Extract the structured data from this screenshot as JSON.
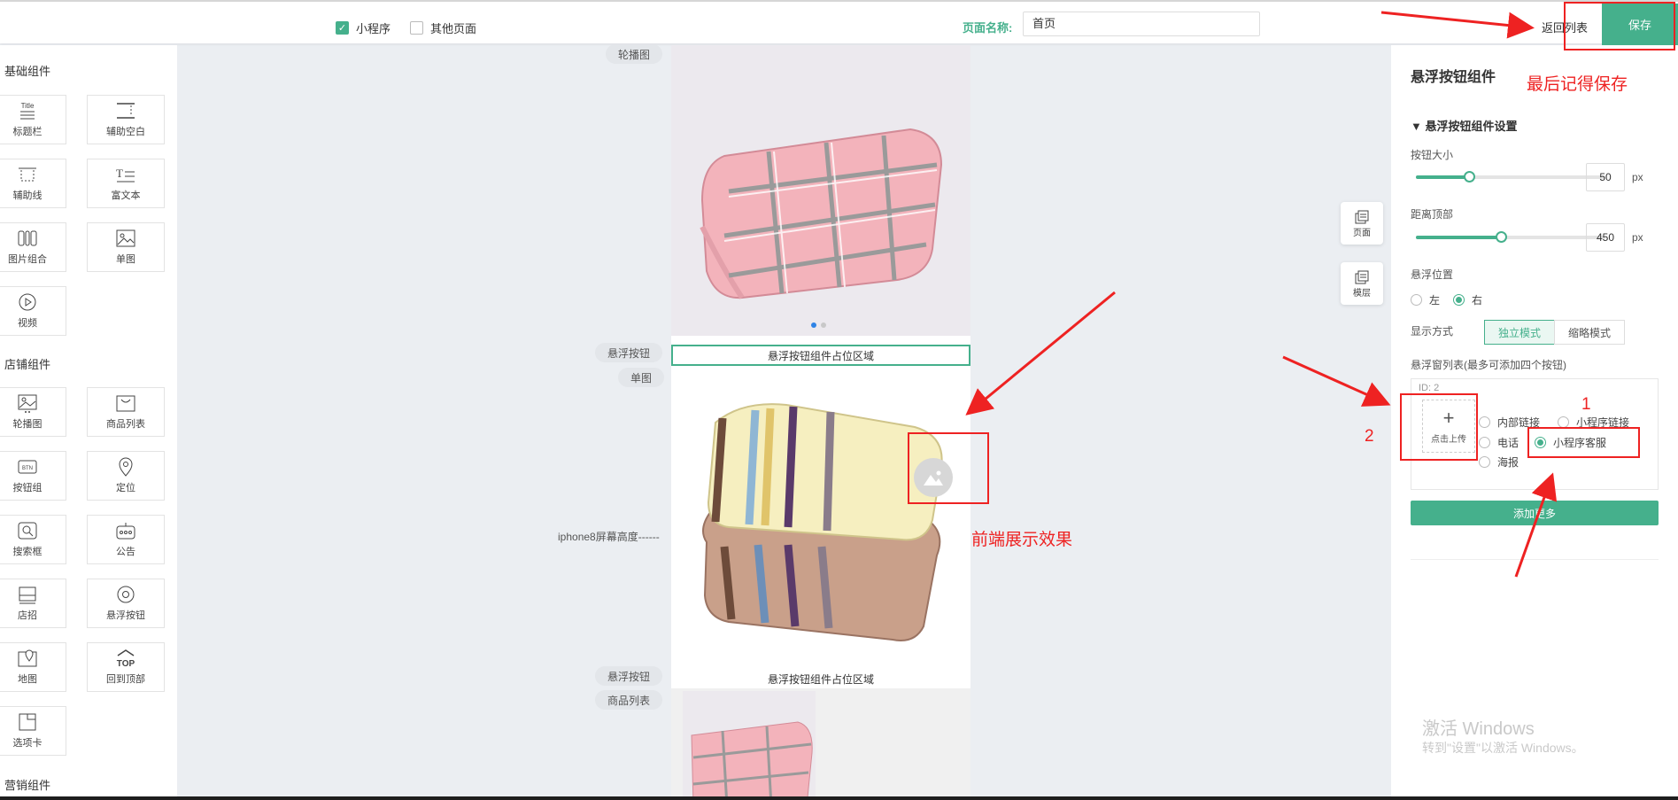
{
  "topbar": {
    "checkbox_miniapp": "小程序",
    "checkbox_other": "其他页面",
    "page_name_label": "页面名称:",
    "page_name_value": "首页",
    "back_list": "返回列表",
    "save": "保存"
  },
  "left": {
    "group_basic": "基础组件",
    "group_shop": "店铺组件",
    "group_marketing": "营销组件",
    "basic_items": [
      "标题栏",
      "辅助空白",
      "辅助线",
      "富文本",
      "图片组合",
      "单图",
      "视频"
    ],
    "shop_items": [
      "轮播图",
      "商品列表",
      "按钮组",
      "定位",
      "搜索框",
      "公告",
      "店招",
      "悬浮按钮",
      "地图",
      "回到顶部",
      "选项卡"
    ],
    "title_icon_text": "Title",
    "top_icon_text": "TOP"
  },
  "canvas": {
    "tag_carousel": "轮播图",
    "tag_float1": "悬浮按钮",
    "tag_single": "单图",
    "tag_float2": "悬浮按钮",
    "tag_goods": "商品列表",
    "placeholder1": "悬浮按钮组件占位区域",
    "placeholder2": "悬浮按钮组件占位区域",
    "iphone_height": "iphone8屏幕高度------",
    "side_page": "页面",
    "side_layer": "模层"
  },
  "right": {
    "title": "悬浮按钮组件",
    "section": "悬浮按钮组件设置",
    "size_label": "按钮大小",
    "size_value": "50",
    "size_fraction": 0.28,
    "top_label": "距离顶部",
    "top_value": "450",
    "top_fraction": 0.45,
    "unit": "px",
    "position_label": "悬浮位置",
    "pos_left": "左",
    "pos_right": "右",
    "display_label": "显示方式",
    "mode_independent": "独立模式",
    "mode_collapse": "缩略模式",
    "list_label": "悬浮窗列表(最多可添加四个按钮)",
    "id_text": "ID: 2",
    "upload": "点击上传",
    "opt_internal": "内部链接",
    "opt_miniapp_link": "小程序链接",
    "opt_phone": "电话",
    "opt_service": "小程序客服",
    "opt_poster": "海报",
    "add_more": "添加更多",
    "win_title": "激活 Windows",
    "win_sub": "转到\"设置\"以激活 Windows。"
  },
  "annotations": {
    "save_reminder": "最后记得保存",
    "frontend_effect": "前端展示效果",
    "num1": "1",
    "num2": "2",
    "color": "#ee2222"
  },
  "colors": {
    "accent": "#45b08c",
    "dot_active": "#2f83e6"
  }
}
